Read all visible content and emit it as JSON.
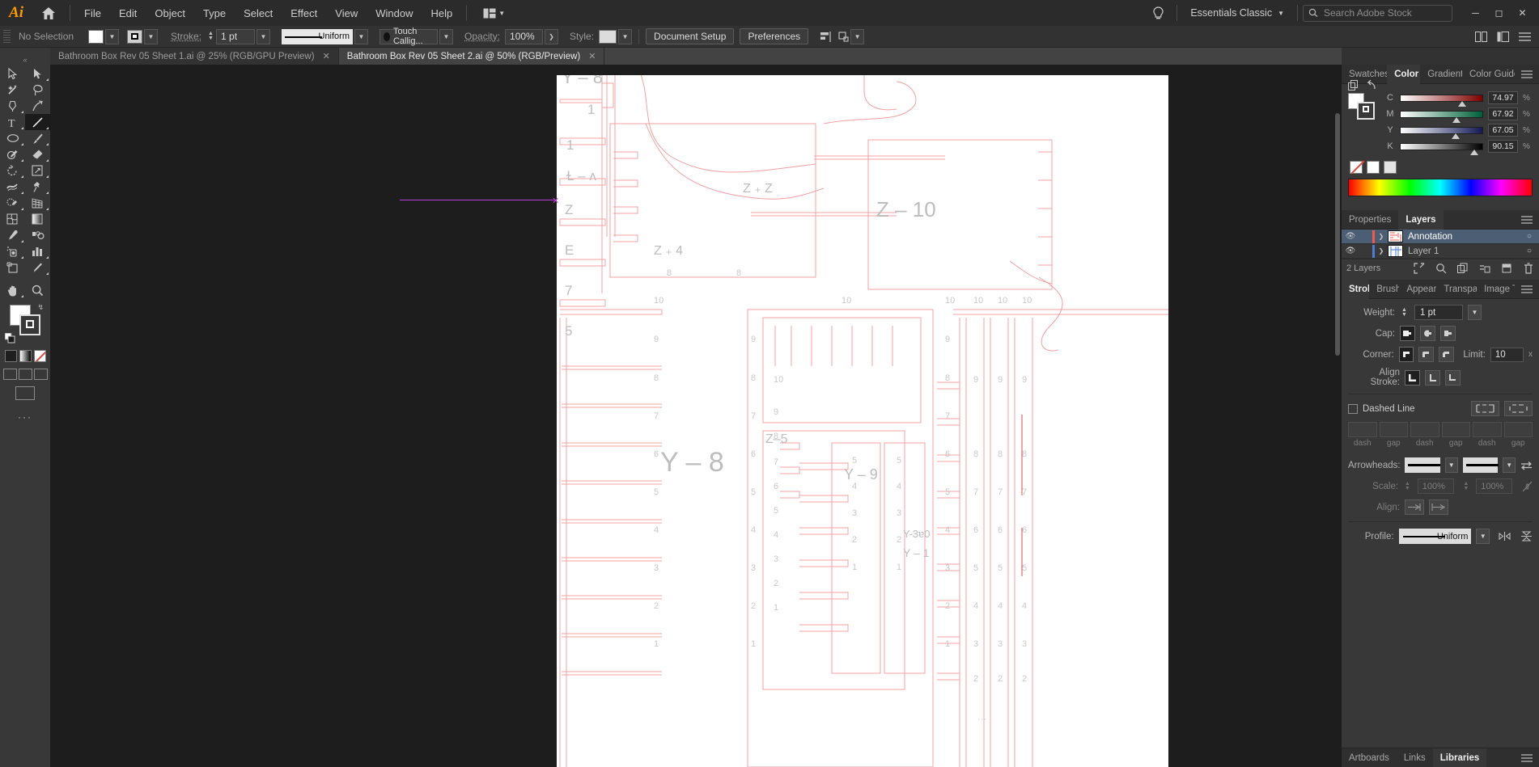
{
  "app": {
    "name": "Adobe Illustrator",
    "logo_text": "Ai",
    "home_icon": "home-icon",
    "arrange_icon": "arrange-documents-icon"
  },
  "menubar": {
    "items": [
      "File",
      "Edit",
      "Object",
      "Type",
      "Select",
      "Effect",
      "View",
      "Window",
      "Help"
    ],
    "workspace": "Essentials Classic",
    "search_placeholder": "Search Adobe Stock",
    "search_value": "",
    "help_icon": "lightbulb-icon",
    "search_icon": "search-icon",
    "window_controls": [
      "minimize",
      "maximize",
      "close"
    ]
  },
  "controlbar": {
    "selection_status": "No Selection",
    "fill_label": "fill-swatch",
    "stroke_color_label": "stroke-swatch",
    "stroke_label": "Stroke:",
    "stroke_weight": "1 pt",
    "variable_width_profile": "Uniform",
    "brush_definition": "Touch Callig...",
    "opacity_label": "Opacity:",
    "opacity_value": "100%",
    "style_label": "Style:",
    "document_setup_button": "Document Setup",
    "preferences_button": "Preferences",
    "align_icon": "align-objects-icon",
    "arrange_icon": "arrange-icon",
    "transform_icon": "transform-icon",
    "extra_menu_icon": "panel-menu-icon"
  },
  "tabs": [
    {
      "title": "Bathroom Box Rev 05 Sheet 1.ai @ 25% (RGB/GPU Preview)",
      "active": false,
      "close": "✕"
    },
    {
      "title": "Bathroom Box Rev 05 Sheet 2.ai @ 50% (RGB/Preview)",
      "active": true,
      "close": "✕"
    }
  ],
  "toolbar": {
    "collapse_icon": "double-chevron-left-icon",
    "tools": [
      {
        "name": "selection-tool",
        "icon": "arrow-outline-icon",
        "selected": false,
        "has_flyout": false
      },
      {
        "name": "direct-selection-tool",
        "icon": "arrow-filled-icon",
        "selected": false,
        "has_flyout": true
      },
      {
        "name": "magic-wand-tool",
        "icon": "magic-wand-icon",
        "selected": false,
        "has_flyout": false
      },
      {
        "name": "lasso-tool",
        "icon": "lasso-icon",
        "selected": false,
        "has_flyout": false
      },
      {
        "name": "pen-tool",
        "icon": "pen-icon",
        "selected": false,
        "has_flyout": true
      },
      {
        "name": "curvature-tool",
        "icon": "curvature-icon",
        "selected": false,
        "has_flyout": false
      },
      {
        "name": "type-tool",
        "icon": "type-T-icon",
        "selected": false,
        "has_flyout": true
      },
      {
        "name": "line-segment-tool",
        "icon": "line-segment-icon",
        "selected": true,
        "has_flyout": true
      },
      {
        "name": "ellipse-tool",
        "icon": "ellipse-icon",
        "selected": false,
        "has_flyout": true
      },
      {
        "name": "paintbrush-tool",
        "icon": "paintbrush-icon",
        "selected": false,
        "has_flyout": true
      },
      {
        "name": "shaper-tool",
        "icon": "shaper-pencil-icon",
        "selected": false,
        "has_flyout": true
      },
      {
        "name": "eraser-tool",
        "icon": "eraser-icon",
        "selected": false,
        "has_flyout": true
      },
      {
        "name": "rotate-tool",
        "icon": "rotate-icon",
        "selected": false,
        "has_flyout": true
      },
      {
        "name": "scale-tool",
        "icon": "scale-icon",
        "selected": false,
        "has_flyout": true
      },
      {
        "name": "width-tool",
        "icon": "width-warp-icon",
        "selected": false,
        "has_flyout": true
      },
      {
        "name": "free-transform-tool",
        "icon": "free-transform-pin-icon",
        "selected": false,
        "has_flyout": true
      },
      {
        "name": "shape-builder-tool",
        "icon": "shape-builder-icon",
        "selected": false,
        "has_flyout": true
      },
      {
        "name": "perspective-grid-tool",
        "icon": "perspective-grid-icon",
        "selected": false,
        "has_flyout": true
      },
      {
        "name": "mesh-tool",
        "icon": "mesh-icon",
        "selected": false,
        "has_flyout": false
      },
      {
        "name": "gradient-tool",
        "icon": "gradient-icon",
        "selected": false,
        "has_flyout": false
      },
      {
        "name": "eyedropper-tool",
        "icon": "eyedropper-icon",
        "selected": false,
        "has_flyout": true
      },
      {
        "name": "blend-tool",
        "icon": "blend-icon",
        "selected": false,
        "has_flyout": false
      },
      {
        "name": "symbol-sprayer-tool",
        "icon": "symbol-sprayer-icon",
        "selected": false,
        "has_flyout": true
      },
      {
        "name": "column-graph-tool",
        "icon": "bar-graph-icon",
        "selected": false,
        "has_flyout": true
      },
      {
        "name": "artboard-tool",
        "icon": "artboard-icon",
        "selected": false,
        "has_flyout": false
      },
      {
        "name": "slice-tool",
        "icon": "slice-knife-icon",
        "selected": false,
        "has_flyout": true
      },
      {
        "name": "hand-tool",
        "icon": "hand-icon",
        "selected": false,
        "has_flyout": true
      },
      {
        "name": "zoom-tool",
        "icon": "magnifier-icon",
        "selected": false,
        "has_flyout": false
      }
    ],
    "fill_stroke": {
      "fill_name": "fill-color-white",
      "stroke_name": "stroke-color-black",
      "swap_icon": "swap-fill-stroke-icon",
      "default_icon": "default-fill-stroke-icon"
    },
    "fill_modes": [
      "color-mode",
      "gradient-mode",
      "none-mode"
    ],
    "draw_modes": [
      "draw-normal",
      "draw-behind",
      "draw-inside"
    ],
    "screen_mode_icon": "change-screen-mode-icon",
    "more_tools": "···"
  },
  "canvas": {
    "document_name": "Bathroom Box Rev 05 Sheet 2.ai",
    "zoom": "50%",
    "guide_color": "#b93fd6",
    "artwork_color": "#f4a0a0",
    "annotation_color": "#bfbfbf",
    "labels_left_top": [
      "Y – 8",
      "1",
      "1",
      "Ɫ – ʎ",
      "Z",
      "E",
      "7",
      "5"
    ],
    "labels_mid": [
      "Z ₊ Z",
      "Z ₊ 4",
      "Y – 8",
      "Y – 9",
      "Y-3ā0",
      "Y – 1",
      "Z–5",
      "Z – 10"
    ],
    "numeric_columns": [
      "10",
      "9",
      "8",
      "7",
      "6",
      "5",
      "4",
      "3",
      "2",
      "1"
    ]
  },
  "color_panel": {
    "tabs": [
      "Swatches",
      "Color",
      "Gradient",
      "Color Guide"
    ],
    "active_tab": "Color",
    "menu_icon": "panel-menu-icon",
    "mode": "CMYK",
    "channels": [
      {
        "label": "C",
        "value": "74.97",
        "unit": "%",
        "percent": 74.97,
        "track_from": "#ffffff",
        "track_to": "#7f0000"
      },
      {
        "label": "M",
        "value": "67.92",
        "unit": "%",
        "percent": 67.92,
        "track_from": "#ffffff",
        "track_to": "#00603a"
      },
      {
        "label": "Y",
        "value": "67.05",
        "unit": "%",
        "percent": 67.05,
        "track_from": "#ffffff",
        "track_to": "#131a55"
      },
      {
        "label": "K",
        "value": "90.15",
        "unit": "%",
        "percent": 90.15,
        "track_from": "#ffffff",
        "track_to": "#000000"
      }
    ],
    "none_swatch": "none-color-swatch",
    "white_swatch": "white-color-swatch",
    "spectrum": "color-spectrum-ramp"
  },
  "layers_panel": {
    "tabs": [
      "Properties",
      "Layers"
    ],
    "active_tab": "Layers",
    "menu_icon": "panel-menu-icon",
    "layers": [
      {
        "name": "Annotation",
        "visible": true,
        "locked": false,
        "color": "#f05a4f",
        "selected": true,
        "target": "○"
      },
      {
        "name": "Layer 1",
        "visible": true,
        "locked": false,
        "color": "#4a7fd4",
        "selected": false,
        "target": "○"
      }
    ],
    "footer_count": "2 Layers",
    "footer_icons": [
      "locate-object-icon",
      "search-layer-icon",
      "make-clipping-mask-icon",
      "create-new-sublayer-icon",
      "create-new-layer-icon",
      "delete-layer-icon"
    ]
  },
  "stroke_panel": {
    "tabs": [
      "Stroke",
      "Brushes",
      "Appearance",
      "Transparency",
      "Image Trace"
    ],
    "active_tab": "Stroke",
    "menu_icon": "panel-menu-icon",
    "weight_label": "Weight:",
    "weight_value": "1 pt",
    "cap_label": "Cap:",
    "cap_options": [
      "butt-cap",
      "round-cap",
      "projecting-cap"
    ],
    "cap_selected": 0,
    "corner_label": "Corner:",
    "corner_options": [
      "miter-join",
      "round-join",
      "bevel-join"
    ],
    "corner_selected": 0,
    "limit_label": "Limit:",
    "limit_value": "10",
    "limit_unit": "x",
    "align_label": "Align Stroke:",
    "align_options": [
      "align-center",
      "align-inside",
      "align-outside"
    ],
    "align_selected": 0,
    "dashed_label": "Dashed Line",
    "dashed_checked": false,
    "dash_buttons": [
      "preserve-exact-dash",
      "align-dashes-to-corners"
    ],
    "dash_captions": [
      "dash",
      "gap",
      "dash",
      "gap",
      "dash",
      "gap"
    ],
    "dash_values": [
      "",
      "",
      "",
      "",
      "",
      ""
    ],
    "arrowheads_label": "Arrowheads:",
    "arrowhead_start": "none-arrowhead",
    "arrowhead_end": "none-arrowhead",
    "swap_arrowheads_icon": "swap-arrowheads-icon",
    "scale_label": "Scale:",
    "scale_start": "100%",
    "scale_end": "100%",
    "link_icon": "link-scale-icon",
    "align_dash_label": "Align:",
    "align_dash_options": [
      "extend-arrowtip",
      "place-arrowtip"
    ],
    "profile_label": "Profile:",
    "profile_value": "Uniform",
    "flip_across_icon": "flip-across-icon",
    "flip_along_icon": "flip-along-icon"
  },
  "bottom_panel": {
    "tabs": [
      "Artboards",
      "Links",
      "Libraries"
    ],
    "active_tab": "Libraries",
    "menu_icon": "panel-menu-icon"
  }
}
